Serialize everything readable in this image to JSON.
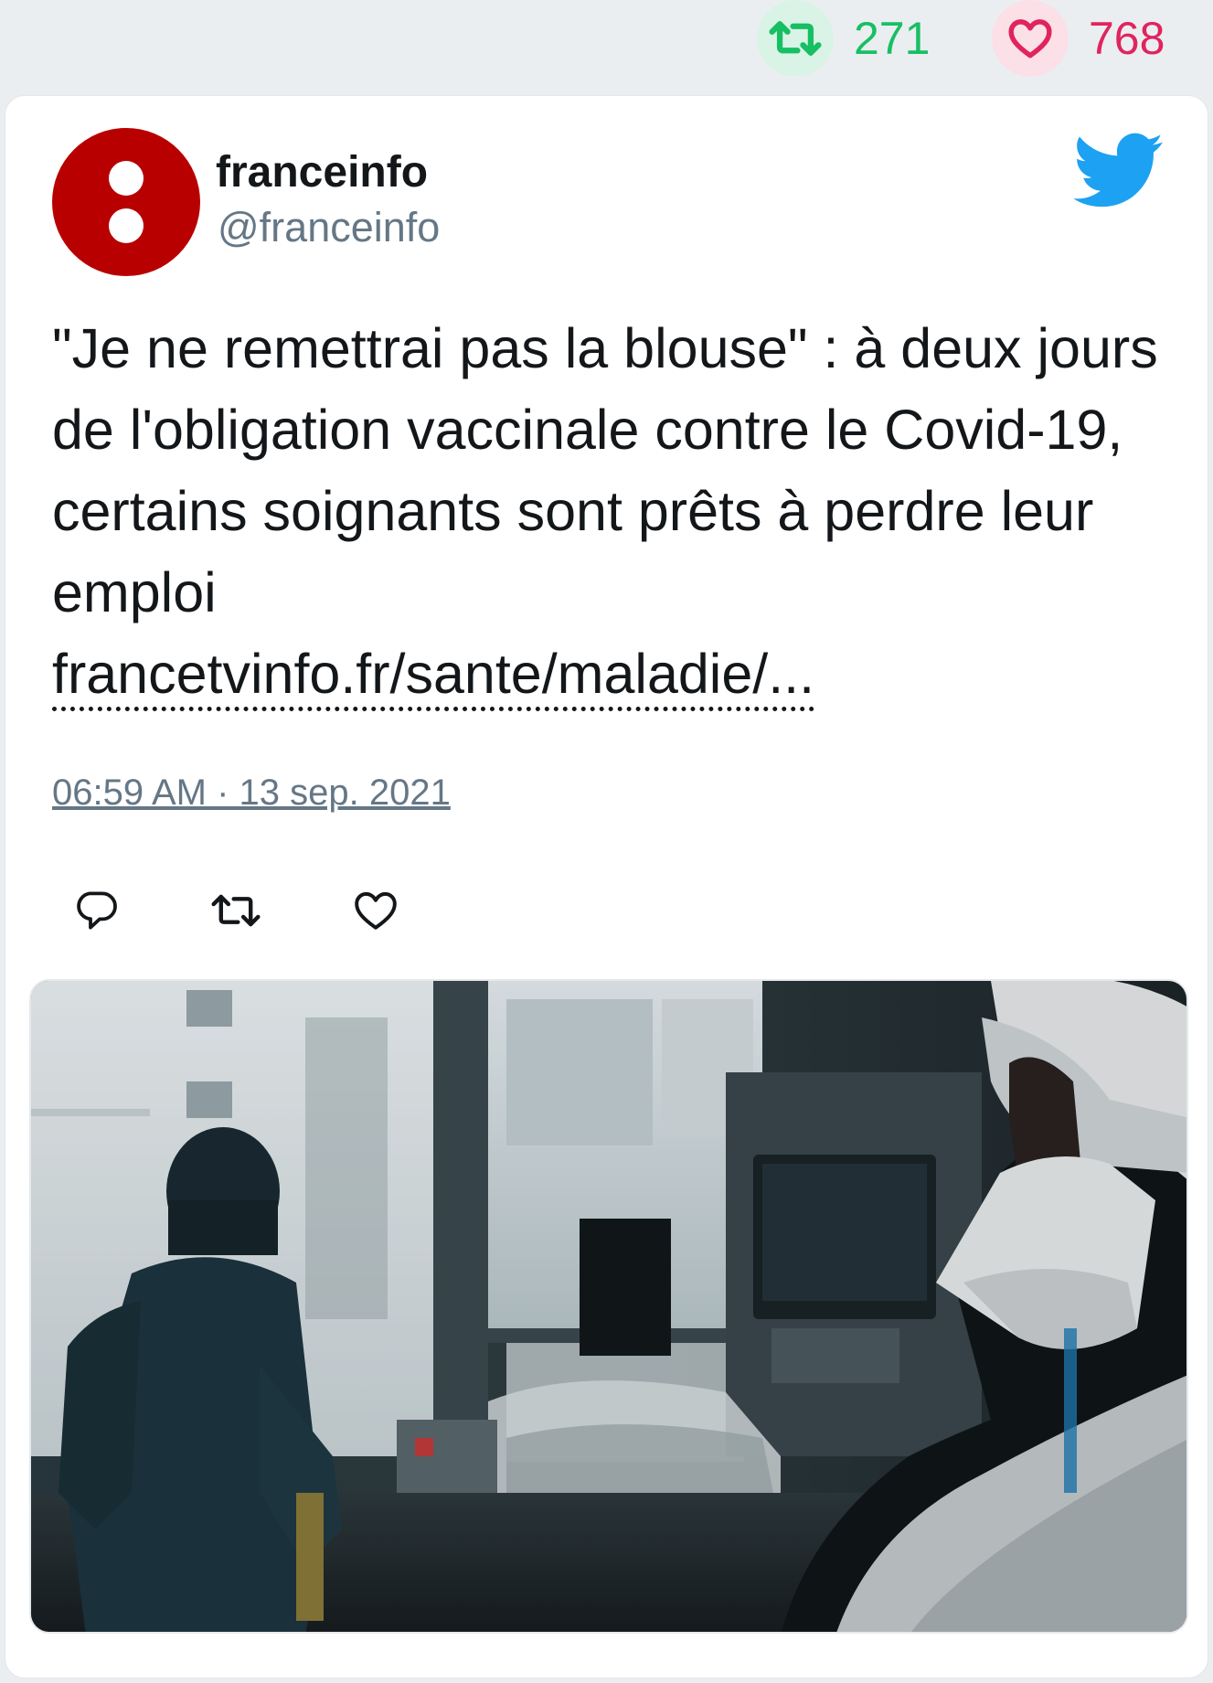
{
  "stats": {
    "retweet_count": "271",
    "like_count": "768",
    "retweet_color": "#17bf63",
    "like_color": "#e0245e"
  },
  "author": {
    "display_name": "franceinfo",
    "handle": "@franceinfo",
    "avatar_color": "#b80000"
  },
  "tweet": {
    "text": "\"Je ne remettrai pas la blouse\" : à deux jours de l'obligation vaccinale contre le Covid-19, certains soignants sont prêts à perdre leur emploi",
    "link_text": "francetvinfo.fr/sante/maladie/...",
    "timestamp": "06:59 AM · 13 sep. 2021"
  },
  "icons": {
    "brand": "twitter-bird-icon",
    "reply": "reply-icon",
    "retweet": "retweet-icon",
    "like": "heart-icon"
  },
  "colors": {
    "twitter_blue": "#1da1f2",
    "text_primary": "#14171a",
    "text_secondary": "#657786"
  }
}
